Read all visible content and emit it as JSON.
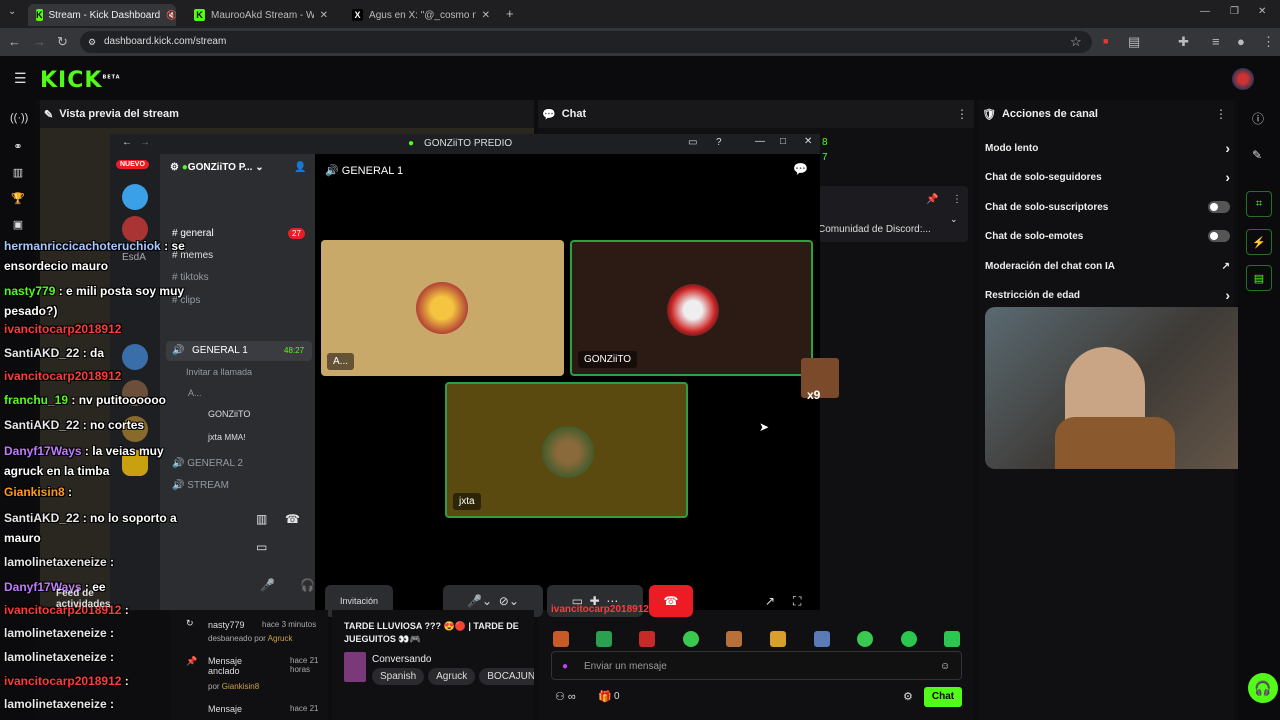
{
  "browser": {
    "tabs": [
      {
        "title": "Stream - Kick Dashboard",
        "favicon": "K"
      },
      {
        "title": "MaurooAkd Stream - Watch Li...",
        "favicon": "K"
      },
      {
        "title": "Agus en X: \"@_cosmo no me...",
        "favicon": "X"
      }
    ],
    "url": "dashboard.kick.com/stream"
  },
  "kick": {
    "logo": "KICK",
    "beta": "BETA",
    "preview_title": "Vista previa del stream",
    "chat_title": "Chat",
    "actions_title": "Acciones de canal",
    "actions": [
      {
        "label": "Modo lento",
        "kind": "arrow"
      },
      {
        "label": "Chat de solo-seguidores",
        "kind": "arrow"
      },
      {
        "label": "Chat de solo-suscriptores",
        "kind": "toggle"
      },
      {
        "label": "Chat de solo-emotes",
        "kind": "toggle"
      },
      {
        "label": "Moderación del chat con IA",
        "kind": "link"
      },
      {
        "label": "Restricción de edad",
        "kind": "arrow"
      }
    ],
    "viewer_counts": [
      "8",
      "7"
    ],
    "pinned_text": "Comunidad de Discord:...",
    "stream_title": "TARDE LLUVIOSA ??? 😍🔴 | TARDE DE JUEGUITOS 👀🎮",
    "category": "Conversando",
    "tags": [
      "Spanish",
      "Agruck",
      "BOCAJUNI"
    ],
    "chat_placeholder": "Enviar un mensaje",
    "chat_button": "Chat",
    "points": "0",
    "feed_title": "Feed de actividades",
    "activity": [
      {
        "user": "nasty779",
        "time": "hace 3 minutos",
        "detail": "desbaneado por",
        "by": "Agruck"
      },
      {
        "user": "Mensaje anclado",
        "time": "hace 21 horas",
        "detail": "por",
        "by": "Giankisin8"
      },
      {
        "user": "Mensaje",
        "time": "hace 21",
        "detail": "",
        "by": ""
      }
    ],
    "recent_chat_user": "ivancitocarp2018912"
  },
  "discord": {
    "window_title": "GONZiiTO PREDIO",
    "server_name": "GONZiiTO P...",
    "nuevo_badge": "NUEVO",
    "esda": "EsdA",
    "channels": [
      {
        "name": "general",
        "badge": "27"
      },
      {
        "name": "memes"
      },
      {
        "name": "tiktoks"
      },
      {
        "name": "clips"
      }
    ],
    "voice_channel": "GENERAL 1",
    "voice_time": "48:27",
    "invite_call": "Invitar a llamada",
    "members": [
      "A...",
      "GONZiiTO",
      "jxta"
    ],
    "member_suffix": "MMA!",
    "other_channels": [
      "GENERAL 2",
      "STREAM"
    ],
    "voice_header": "GENERAL 1",
    "tiles": [
      {
        "label": "A...",
        "bg": "#c8a96a"
      },
      {
        "label": "GONZiiTO",
        "bg": "#2c1b14"
      },
      {
        "label": "jxta",
        "bg": "#5a4a10"
      }
    ],
    "invite_button": "Invitación",
    "sticker_count": "x9"
  },
  "overlay_chat": [
    {
      "user": "hermanriccicachoteruchiok",
      "msg": ": se ensordecio mauro",
      "color": "#a9c6ff"
    },
    {
      "user": "nasty779",
      "msg": ": e mili posta soy muy pesado?)",
      "color": "#53fc18"
    },
    {
      "user": "ivancitocarp2018912",
      "msg": "",
      "color": "#ff3b3b"
    },
    {
      "user": "SantiAKD_22",
      "msg": ": da",
      "color": "#e8e8e8"
    },
    {
      "user": "ivancitocarp2018912",
      "msg": "",
      "color": "#ff3b3b"
    },
    {
      "user": "franchu_19",
      "msg": ": nv putitoooooo",
      "color": "#53fc18"
    },
    {
      "user": "SantiAKD_22",
      "msg": ": no cortes",
      "color": "#e8e8e8"
    },
    {
      "user": "Danyf17Ways",
      "msg": ": la veias muy agruck en la timba",
      "color": "#c07bff"
    },
    {
      "user": "Giankisin8",
      "msg": ":",
      "color": "#ff9a1f"
    },
    {
      "user": "SantiAKD_22",
      "msg": ": no lo soporto a mauro",
      "color": "#e8e8e8"
    },
    {
      "user": "lamolinetaxeneize",
      "msg": ":",
      "color": "#e8e8e8"
    },
    {
      "user": "Danyf17Ways",
      "msg": ": ee",
      "color": "#c07bff"
    },
    {
      "user": "ivancitocarp2018912",
      "msg": ":",
      "color": "#ff3b3b"
    },
    {
      "user": "lamolinetaxeneize",
      "msg": ":",
      "color": "#e8e8e8"
    },
    {
      "user": "lamolinetaxeneize",
      "msg": ":",
      "color": "#e8e8e8"
    },
    {
      "user": "ivancitocarp2018912",
      "msg": ":",
      "color": "#ff3b3b"
    },
    {
      "user": "lamolinetaxeneize",
      "msg": ":",
      "color": "#e8e8e8"
    },
    {
      "user": "ivancitocarp2018912",
      "msg": ":",
      "color": "#ff3b3b"
    }
  ],
  "colors": {
    "accent": "#53fc18",
    "bg": "#0b0b0d",
    "hangup": "#ed1c24"
  }
}
